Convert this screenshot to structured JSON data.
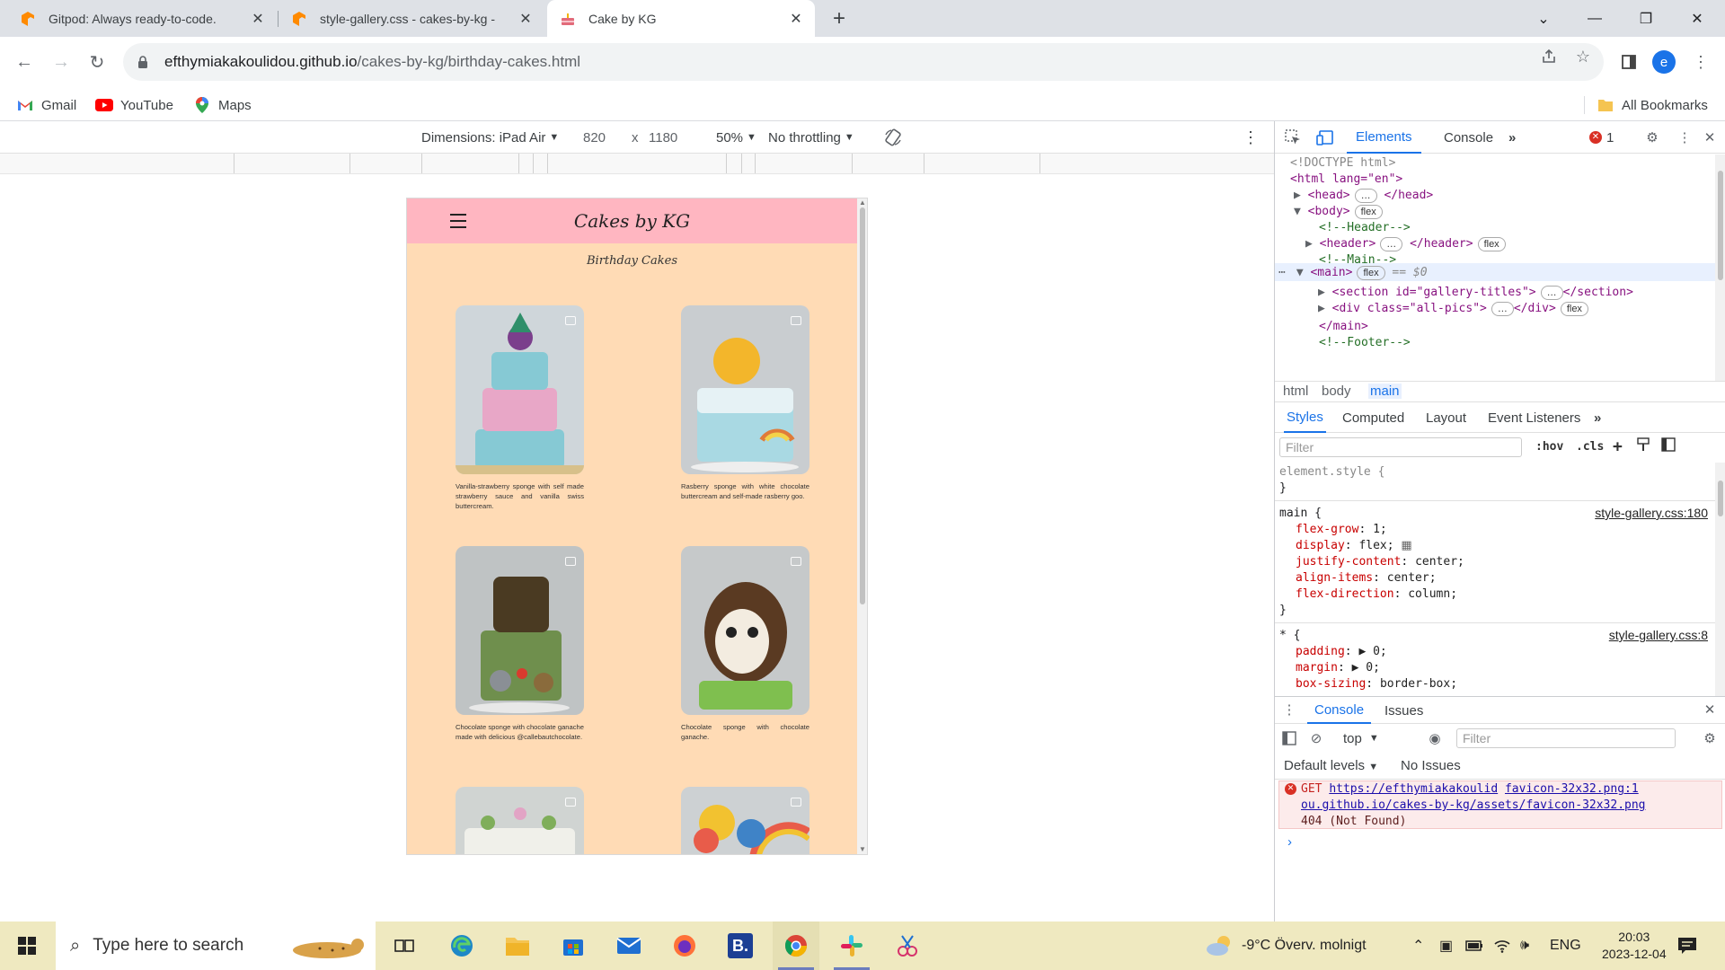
{
  "browser": {
    "tabs": [
      {
        "title": "Gitpod: Always ready-to-code.",
        "active": false
      },
      {
        "title": "style-gallery.css - cakes-by-kg -",
        "active": false
      },
      {
        "title": "Cake by KG",
        "active": true
      }
    ],
    "url_host": "efthymiakakoulidou.github.io",
    "url_path": "/cakes-by-kg/birthday-cakes.html",
    "profile_initial": "e",
    "bookmarks": [
      {
        "label": "Gmail"
      },
      {
        "label": "YouTube"
      },
      {
        "label": "Maps"
      }
    ],
    "all_bookmarks": "All Bookmarks"
  },
  "device_toolbar": {
    "dimensions": "Dimensions: iPad Air",
    "width": "820",
    "times": "x",
    "height": "1180",
    "zoom": "50%",
    "throttling": "No throttling"
  },
  "site": {
    "title": "Cakes by KG",
    "gallery_title": "Birthday Cakes",
    "cards": [
      {
        "desc": "Vanilla-strawberry sponge with self made strawberry sauce and vanilla swiss buttercream.",
        "palette": [
          "#cfd6da",
          "#e8a7c7",
          "#86c9d4",
          "#7b3f8c"
        ]
      },
      {
        "desc": "Rasberry sponge with white chocolate buttercream and self-made rasberry goo.",
        "palette": [
          "#c9cdd0",
          "#f3b62b",
          "#a9d9e3",
          "#e07b39"
        ]
      },
      {
        "desc": "Chocolate sponge with chocolate ganache made with delicious @callebautchocolate.",
        "palette": [
          "#bfc3c4",
          "#4a3a22",
          "#6f8f4d",
          "#8a6b3c"
        ]
      },
      {
        "desc": "Chocolate sponge with chocolate ganache.",
        "palette": [
          "#c6c9ca",
          "#5a3a22",
          "#7fbf4f",
          "#f3ece0"
        ]
      },
      {
        "desc": "",
        "palette": [
          "#d0d4d2",
          "#7fae5a",
          "#e2a4c5",
          "#f0f0ea"
        ]
      },
      {
        "desc": "",
        "palette": [
          "#cdd1d3",
          "#e85c4a",
          "#f2c230",
          "#3f83c7"
        ]
      }
    ]
  },
  "devtools": {
    "tabs": [
      "Elements",
      "Console"
    ],
    "error_count": "1",
    "dom": {
      "doctype": "<!DOCTYPE html>",
      "html_open": "<html lang=\"en\">",
      "head": "<head>",
      "head_close": "</head>",
      "body": "<body>",
      "comment_header": "<!--Header-->",
      "header": "<header>",
      "header_close": "</header>",
      "comment_main": "<!--Main-->",
      "main": "<main>",
      "selected_marker": "== $0",
      "section_open": "<section id=\"gallery-titles\">",
      "section_close": "</section>",
      "div_open": "<div class=\"all-pics\">",
      "div_close": "</div>",
      "main_close": "</main>",
      "comment_footer": "<!--Footer-->",
      "pill_flex": "flex",
      "ellipsis": "…"
    },
    "breadcrumbs": [
      "html",
      "body",
      "main"
    ],
    "sub_tabs": [
      "Styles",
      "Computed",
      "Layout",
      "Event Listeners"
    ],
    "filter_placeholder": "Filter",
    "hov": ":hov",
    "cls": ".cls",
    "styles": {
      "element_style": "element.style {",
      "close": "}",
      "main_selector": "main {",
      "main_link": "style-gallery.css:180",
      "main_props": [
        {
          "p": "flex-grow",
          "v": "1;"
        },
        {
          "p": "display",
          "v": "flex;"
        },
        {
          "p": "justify-content",
          "v": "center;"
        },
        {
          "p": "align-items",
          "v": "center;"
        },
        {
          "p": "flex-direction",
          "v": "column;"
        }
      ],
      "star_selector": "* {",
      "star_link": "style-gallery.css:8",
      "star_props": [
        {
          "p": "padding",
          "v": "▶ 0;"
        },
        {
          "p": "margin",
          "v": "▶ 0;"
        },
        {
          "p": "box-sizing",
          "v": "border-box;"
        }
      ]
    },
    "drawer": {
      "tabs": [
        "Console",
        "Issues"
      ],
      "context": "top",
      "filter_placeholder": "Filter",
      "levels": "Default levels",
      "issues": "No Issues",
      "error_get": "GET",
      "error_url_a": "https://efthymiakakoulid",
      "error_source": "favicon-32x32.png:1",
      "error_url_b": "ou.github.io/cakes-by-kg/assets/favicon-32x32.png",
      "error_status": "404 (Not Found)"
    }
  },
  "taskbar": {
    "search_placeholder": "Type here to search",
    "weather": "-9°C  Överv. molnigt",
    "lang": "ENG",
    "time": "20:03",
    "date": "2023-12-04"
  }
}
